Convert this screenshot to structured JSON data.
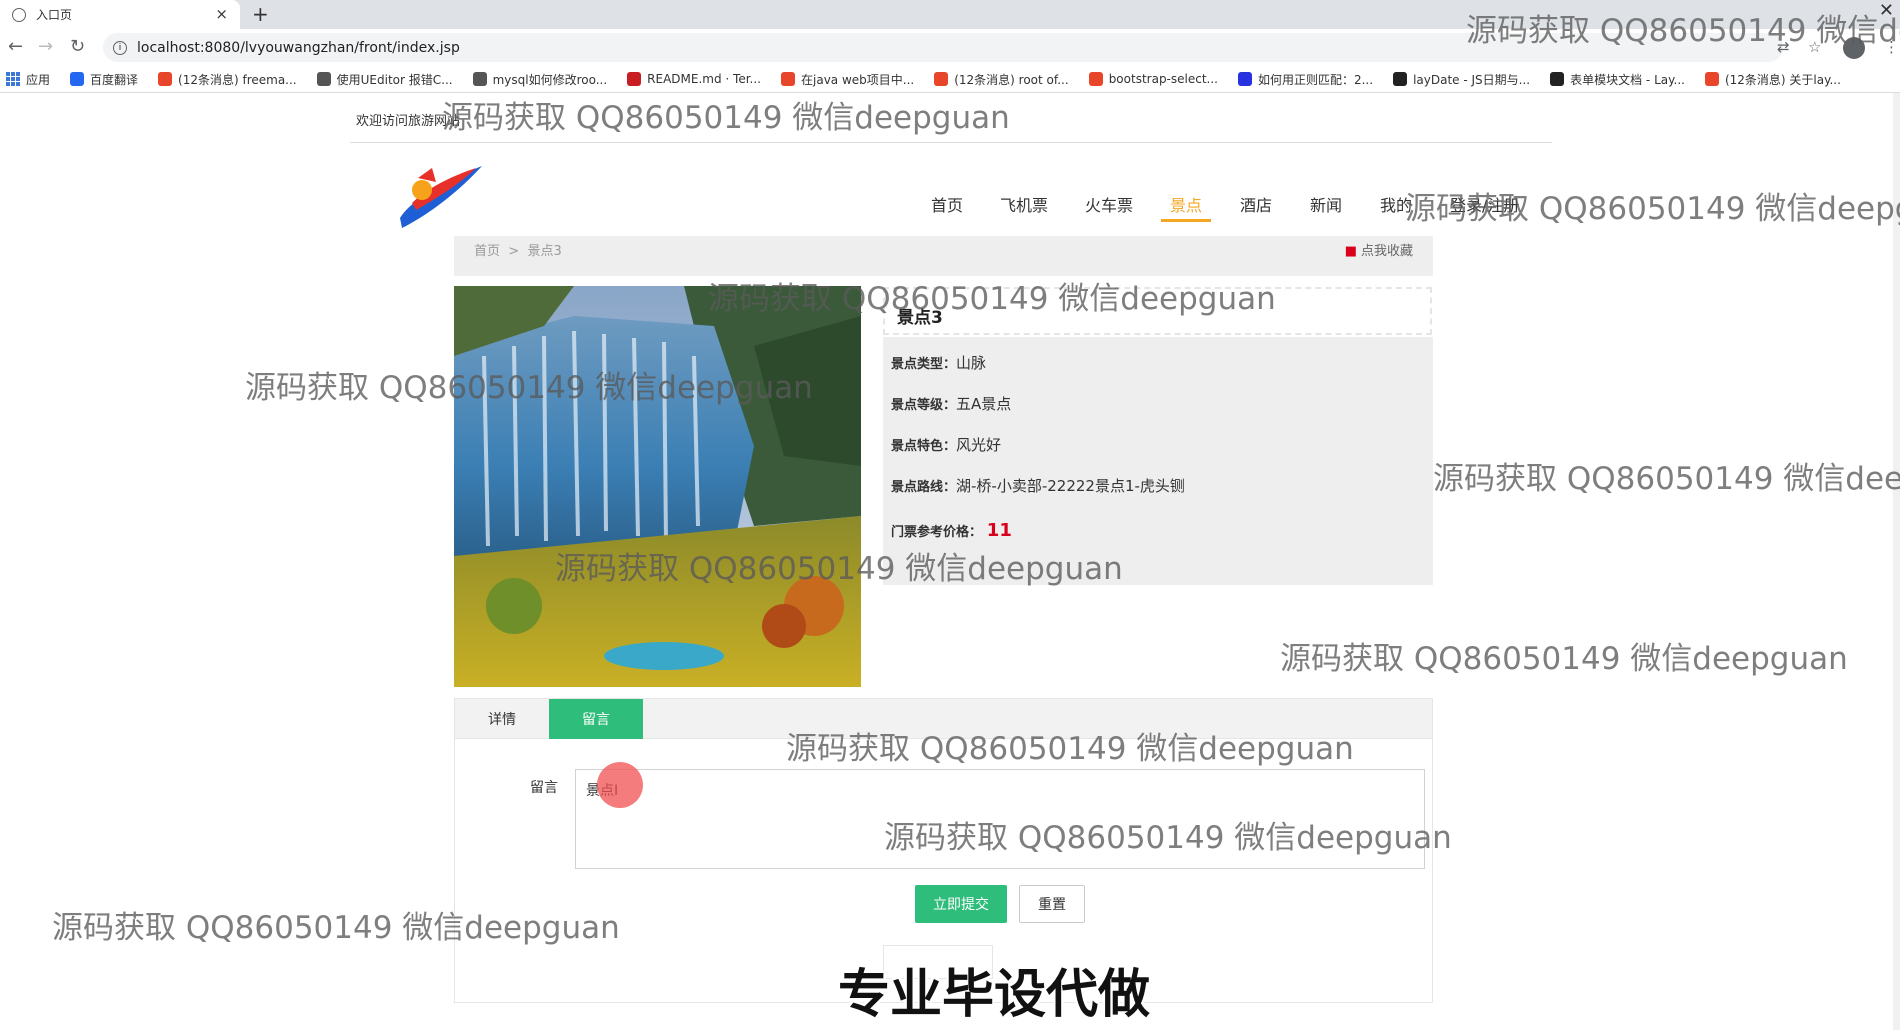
{
  "browser": {
    "tab_title": "入口页",
    "tab_close": "×",
    "new_tab": "+",
    "url": "localhost:8080/lvyouwangzhan/front/index.jsp",
    "bookmarks": [
      {
        "label": "应用",
        "color": "#3c78d8",
        "icon": "apps-icon"
      },
      {
        "label": "百度翻译",
        "color": "#2468f2",
        "icon": "translate-icon"
      },
      {
        "label": "(12条消息) freema...",
        "color": "#e8462b",
        "icon": "csdn-icon"
      },
      {
        "label": "使用UEditor 报错C...",
        "color": "#555555",
        "icon": "ueditor-icon"
      },
      {
        "label": "mysql如何修改roo...",
        "color": "#555555",
        "icon": "mysql-icon"
      },
      {
        "label": "README.md · Ter...",
        "color": "#c71d23",
        "icon": "gitee-icon"
      },
      {
        "label": "在java web项目中...",
        "color": "#e8462b",
        "icon": "csdn-icon"
      },
      {
        "label": "(12条消息) root of...",
        "color": "#e8462b",
        "icon": "csdn-icon"
      },
      {
        "label": "bootstrap-select...",
        "color": "#e8462b",
        "icon": "cnblogs-icon"
      },
      {
        "label": "如何用正则匹配：2...",
        "color": "#2932e1",
        "icon": "baidu-icon"
      },
      {
        "label": "layDate - JS日期与...",
        "color": "#222222",
        "icon": "layui-icon"
      },
      {
        "label": "表单模块文档 - Lay...",
        "color": "#222222",
        "icon": "layui-icon"
      },
      {
        "label": "(12条消息) 关于lay...",
        "color": "#e8462b",
        "icon": "csdn-icon"
      }
    ]
  },
  "site": {
    "welcome": "欢迎访问旅游网站",
    "nav": [
      {
        "label": "首页",
        "active": false
      },
      {
        "label": "飞机票",
        "active": false
      },
      {
        "label": "火车票",
        "active": false
      },
      {
        "label": "景点",
        "active": true
      },
      {
        "label": "酒店",
        "active": false
      },
      {
        "label": "新闻",
        "active": false
      },
      {
        "label": "我的",
        "active": false
      },
      {
        "label": "登录/注册",
        "active": false
      }
    ],
    "accent": "#f5a623"
  },
  "breadcrumb": {
    "home": "首页",
    "sep": ">",
    "current": "景点3"
  },
  "favorite": {
    "label": "点我收藏",
    "icon": "bookmark-icon"
  },
  "spot": {
    "title": "景点3",
    "rows": [
      {
        "label": "景点类型：",
        "value": "山脉"
      },
      {
        "label": "景点等级：",
        "value": "五A景点"
      },
      {
        "label": "景点特色：",
        "value": "风光好"
      },
      {
        "label": "景点路线：",
        "value": "湖-桥-小卖部-22222景点1-虎头铡"
      }
    ],
    "price_label": "门票参考价格：",
    "price": "11",
    "price_color": "#d9001b"
  },
  "tabs": {
    "items": [
      {
        "label": "详情",
        "active": false
      },
      {
        "label": "留言",
        "active": true
      }
    ],
    "active_color": "#2ebd7a"
  },
  "comment_form": {
    "label": "留言",
    "value": "景点I",
    "submit": "立即提交",
    "reset": "重置"
  },
  "overlay": {
    "watermark": "源码获取 QQ86050149 微信deepguan",
    "banner": "专业毕设代做"
  }
}
